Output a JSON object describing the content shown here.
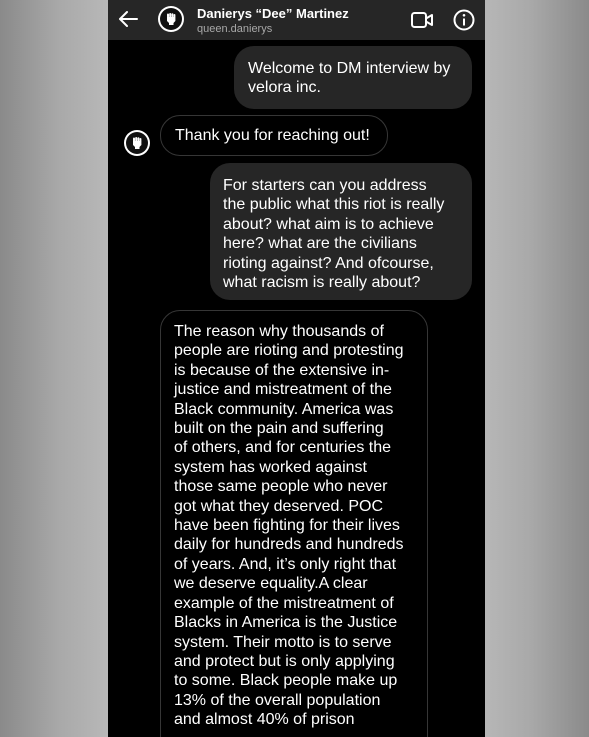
{
  "header": {
    "name": "Danierys “Dee” Martinez",
    "handle": "queen.danierys"
  },
  "messages": [
    {
      "side": "sent",
      "text": "Welcome to DM interview by\nvelora inc."
    },
    {
      "side": "received",
      "text": "Thank you for reaching out!"
    },
    {
      "side": "sent",
      "text": "For starters can you address\nthe public what this riot is really\nabout? what aim is to achieve\nhere? what are the civilians\nrioting against? And ofcourse,\nwhat racism is really about?"
    },
    {
      "side": "received",
      "text": "The reason why thousands of\npeople are rioting and protesting\nis because of the extensive in-\njustice and mistreatment of the\nBlack community. America was\nbuilt on the pain and suffering\nof others, and for centuries the\nsystem has worked against\nthose same people who never\ngot what they deserved. POC\nhave been fighting for their lives\ndaily for hundreds and hundreds\nof years. And, it’s only right that\nwe deserve equality.A clear\nexample of the mistreatment of\nBlacks in America is the Justice\nsystem. Their motto is to serve\nand protect but is only applying\nto some. Black people make up\n13% of the overall population\nand almost 40% of prison"
    }
  ],
  "icons": {
    "back": "arrow-left-icon",
    "video": "video-call-icon",
    "info": "info-icon",
    "avatar": "raised-fist-icon"
  },
  "colors": {
    "background": "#000000",
    "header": "#262626",
    "sent_bubble": "#262626",
    "received_border": "#363636",
    "text": "#ffffff",
    "secondary_text": "#a8a8a8"
  }
}
